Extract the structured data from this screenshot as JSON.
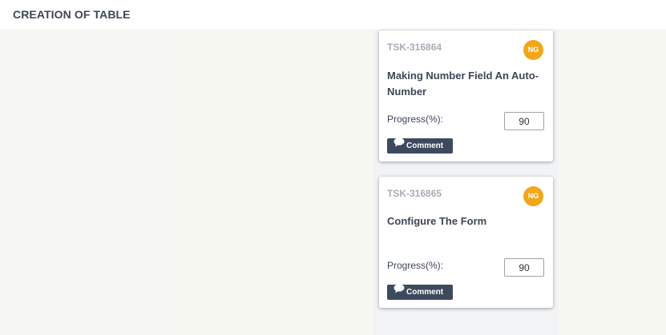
{
  "header": {
    "title": "CREATION OF TABLE"
  },
  "cards": [
    {
      "id": "TSK-316864",
      "avatar": "NG",
      "title": "Making Number Field An Auto-Number",
      "progress_label": "Progress(%):",
      "progress_value": "90",
      "comment_label": "Comment"
    },
    {
      "id": "TSK-316865",
      "avatar": "NG",
      "title": "Configure The Form",
      "progress_label": "Progress(%):",
      "progress_value": "90",
      "comment_label": "Comment"
    }
  ],
  "colors": {
    "avatar": "#f2a61a",
    "comment_button": "#3d4a5e",
    "title_text": "#3d4656",
    "id_text": "#a6adb8"
  },
  "icons": {
    "comment": "speech-bubble-icon"
  }
}
